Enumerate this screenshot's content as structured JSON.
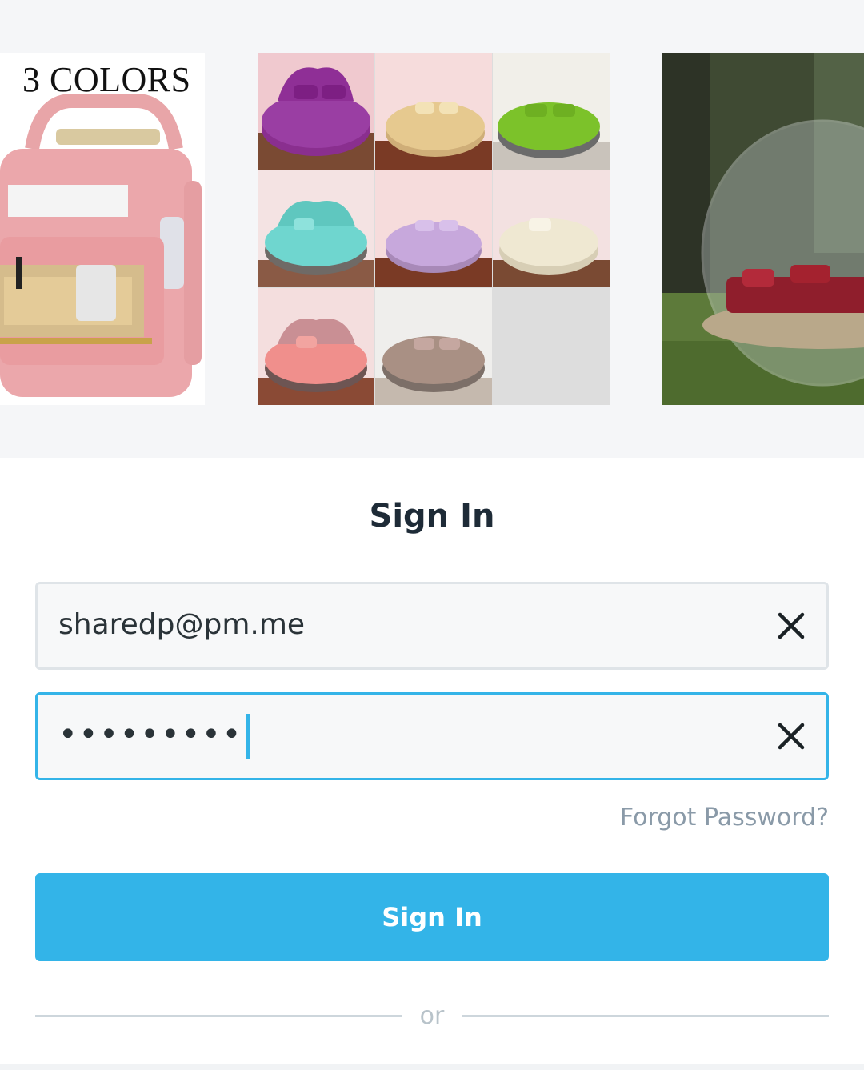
{
  "hero": {
    "tiles": [
      {
        "name": "pink-backpack",
        "caption": "3 COLORS"
      },
      {
        "name": "round-bed-sheets-grid"
      },
      {
        "name": "bubble-tent"
      }
    ]
  },
  "form": {
    "title": "Sign In",
    "email": {
      "value": "sharedp@pm.me",
      "clear_icon": "close-icon"
    },
    "password": {
      "masked_value": "•••••••••",
      "clear_icon": "close-icon"
    },
    "forgot_label": "Forgot Password?",
    "submit_label": "Sign In",
    "divider_label": "or"
  },
  "colors": {
    "accent": "#33b4e8",
    "title": "#1e2b37",
    "muted": "#8a9aa8"
  }
}
